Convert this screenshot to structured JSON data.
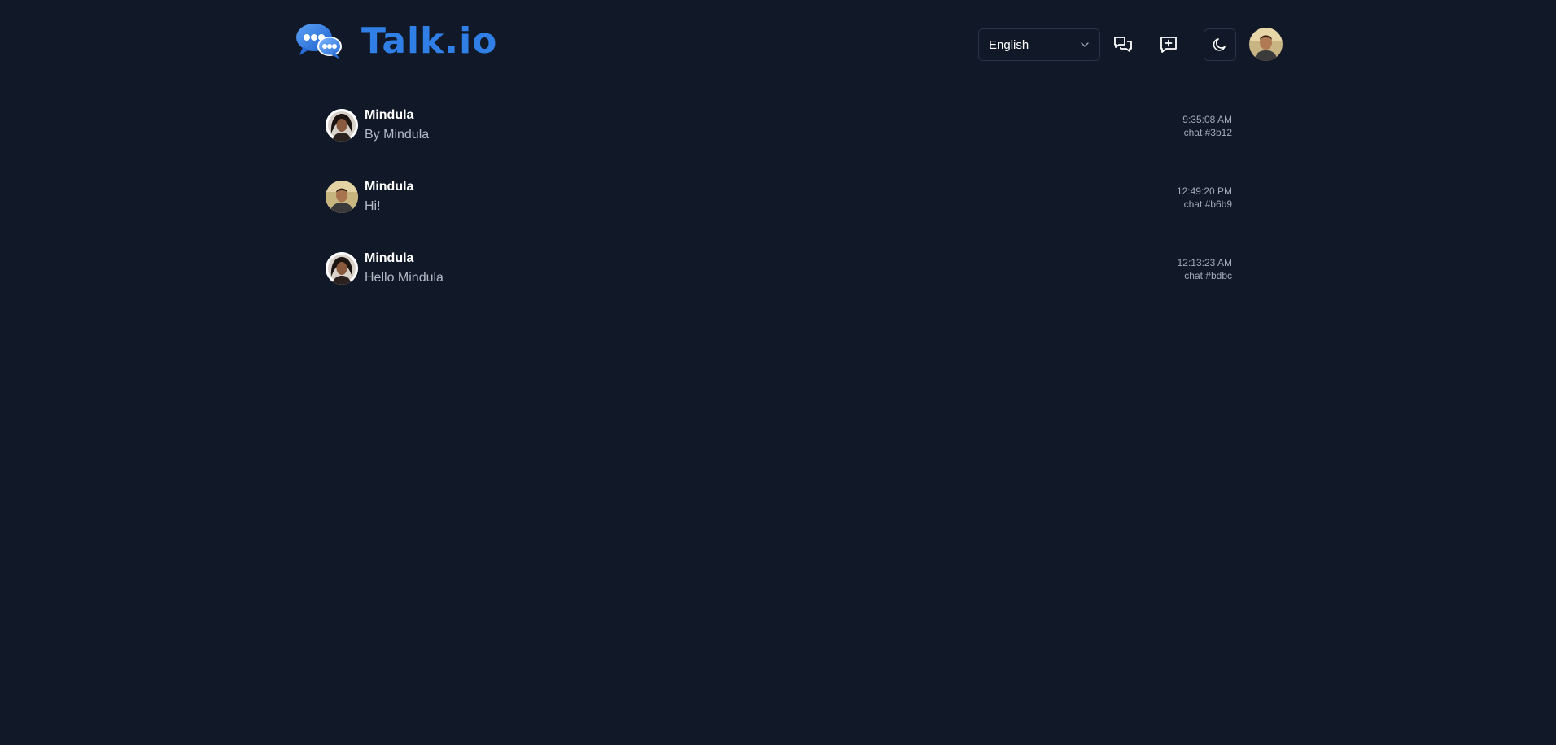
{
  "app": {
    "title": "Talk.io",
    "brand_color": "#2f7fe6",
    "background": "#111827"
  },
  "header": {
    "language": {
      "selected": "English"
    },
    "icons": {
      "chats": "chats-icon",
      "new_chat": "new-chat-icon",
      "theme": "moon-icon",
      "profile": "avatar"
    }
  },
  "chats": [
    {
      "name": "Mindula",
      "message": "By Mindula",
      "time": "9:35:08 AM",
      "chat_id": "chat #3b12"
    },
    {
      "name": "Mindula",
      "message": "Hi!",
      "time": "12:49:20 PM",
      "chat_id": "chat #b6b9"
    },
    {
      "name": "Mindula",
      "message": "Hello Mindula",
      "time": "12:13:23 AM",
      "chat_id": "chat #bdbc"
    }
  ]
}
